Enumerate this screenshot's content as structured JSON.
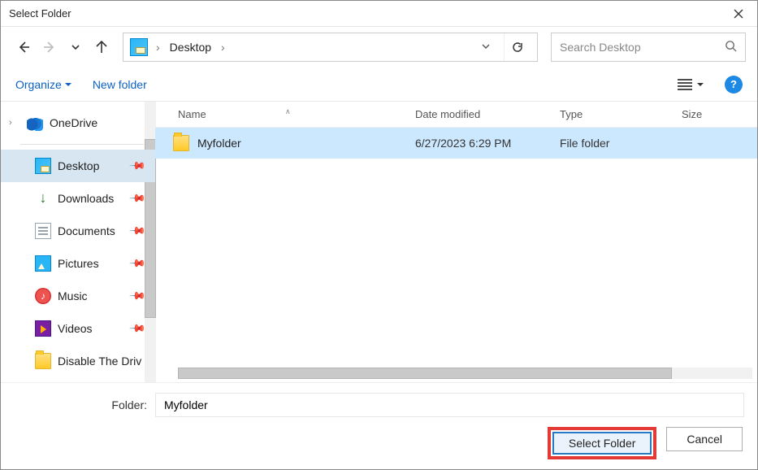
{
  "title": "Select Folder",
  "address": {
    "location": "Desktop"
  },
  "search": {
    "placeholder": "Search Desktop"
  },
  "toolbar": {
    "organize": "Organize",
    "newfolder": "New folder"
  },
  "columns": {
    "name": "Name",
    "date": "Date modified",
    "type": "Type",
    "size": "Size"
  },
  "sidebar": {
    "onedrive": "OneDrive",
    "items": [
      {
        "label": "Desktop"
      },
      {
        "label": "Downloads"
      },
      {
        "label": "Documents"
      },
      {
        "label": "Pictures"
      },
      {
        "label": "Music"
      },
      {
        "label": "Videos"
      },
      {
        "label": "Disable The Driv"
      }
    ]
  },
  "files": [
    {
      "name": "Myfolder",
      "date": "6/27/2023 6:29 PM",
      "type": "File folder"
    }
  ],
  "footer": {
    "label": "Folder:",
    "value": "Myfolder",
    "select": "Select Folder",
    "cancel": "Cancel"
  }
}
